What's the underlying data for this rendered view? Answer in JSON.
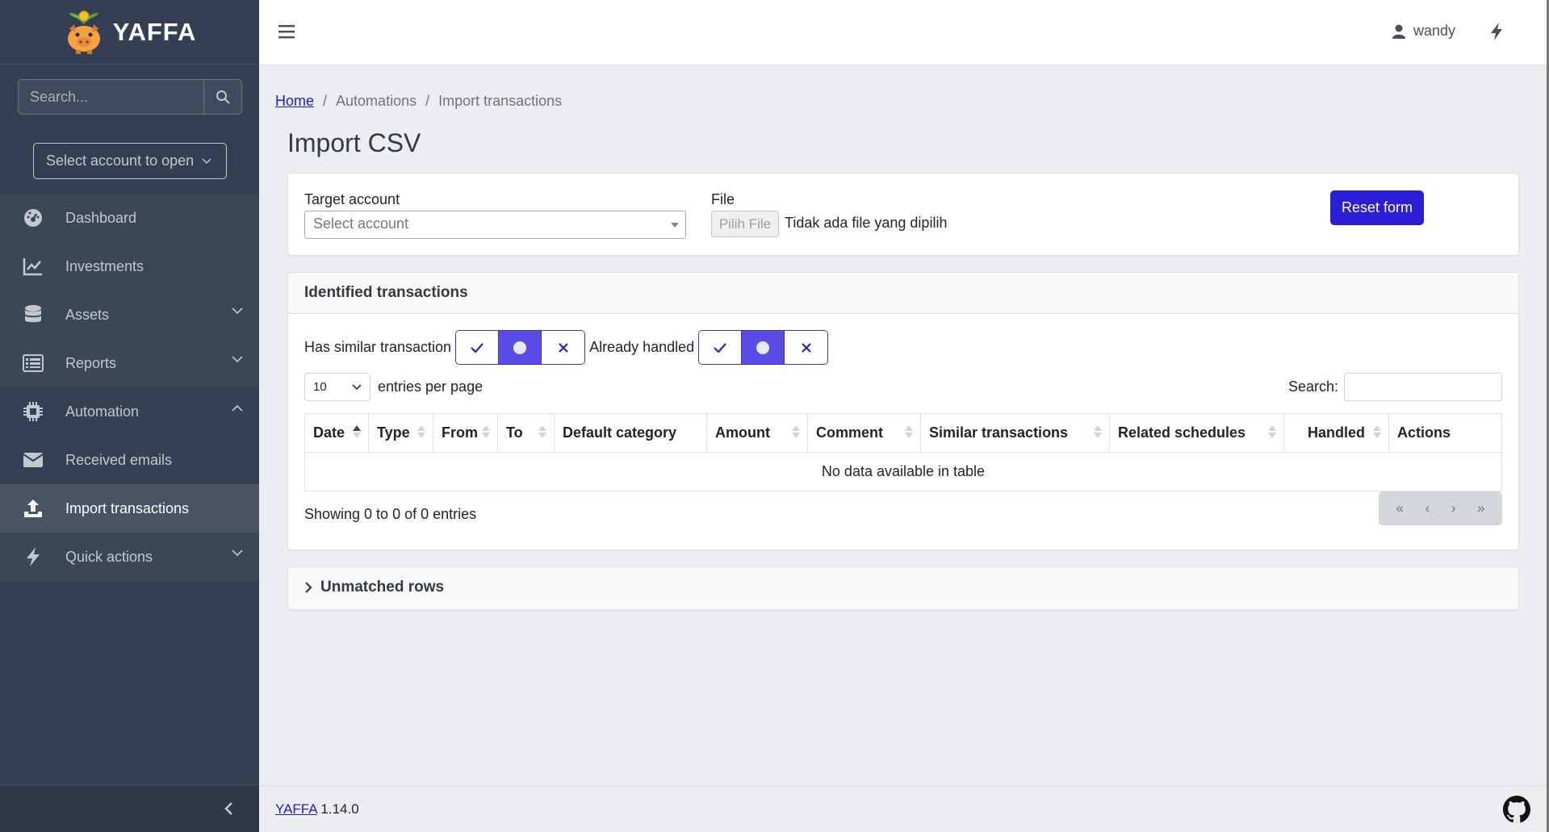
{
  "brand": {
    "name": "YAFFA"
  },
  "sidebar": {
    "search_placeholder": "Search...",
    "account_select": "Select account to open",
    "items": [
      {
        "label": "Dashboard",
        "icon": "gauge-icon"
      },
      {
        "label": "Investments",
        "icon": "chart-line-icon"
      },
      {
        "label": "Assets",
        "icon": "database-icon"
      },
      {
        "label": "Reports",
        "icon": "list-icon"
      },
      {
        "label": "Automation",
        "icon": "chip-icon"
      },
      {
        "label": "Received emails",
        "icon": "envelope-icon"
      },
      {
        "label": "Import transactions",
        "icon": "upload-icon"
      },
      {
        "label": "Quick actions",
        "icon": "bolt-icon"
      }
    ]
  },
  "topbar": {
    "username": "wandy"
  },
  "breadcrumb": {
    "home": "Home",
    "sep": "/",
    "level2": "Automations",
    "level3": "Import transactions"
  },
  "page": {
    "title": "Import CSV"
  },
  "form": {
    "target_label": "Target account",
    "target_placeholder": "Select account",
    "file_label": "File",
    "file_button": "Pilih File",
    "file_none": "Tidak ada file yang dipilih",
    "reset_label": "Reset form"
  },
  "identified": {
    "title": "Identified transactions",
    "filter_similar_label": "Has similar transaction",
    "filter_handled_label": "Already handled",
    "length_value": "10",
    "length_suffix": "entries per page",
    "search_label": "Search:",
    "columns": [
      "Date",
      "Type",
      "From",
      "To",
      "Default category",
      "Amount",
      "Comment",
      "Similar transactions",
      "Related schedules",
      "Handled",
      "Actions"
    ],
    "empty": "No data available in table",
    "info": "Showing 0 to 0 of 0 entries",
    "pager": [
      "«",
      "‹",
      "›",
      "»"
    ]
  },
  "unmatched": {
    "title": "Unmatched rows"
  },
  "footer": {
    "link": "YAFFA",
    "version": "1.14.0"
  },
  "colors": {
    "sidebar": "#343f53",
    "accent": "#2a1ed6",
    "toggle_on": "#5b4be6"
  }
}
